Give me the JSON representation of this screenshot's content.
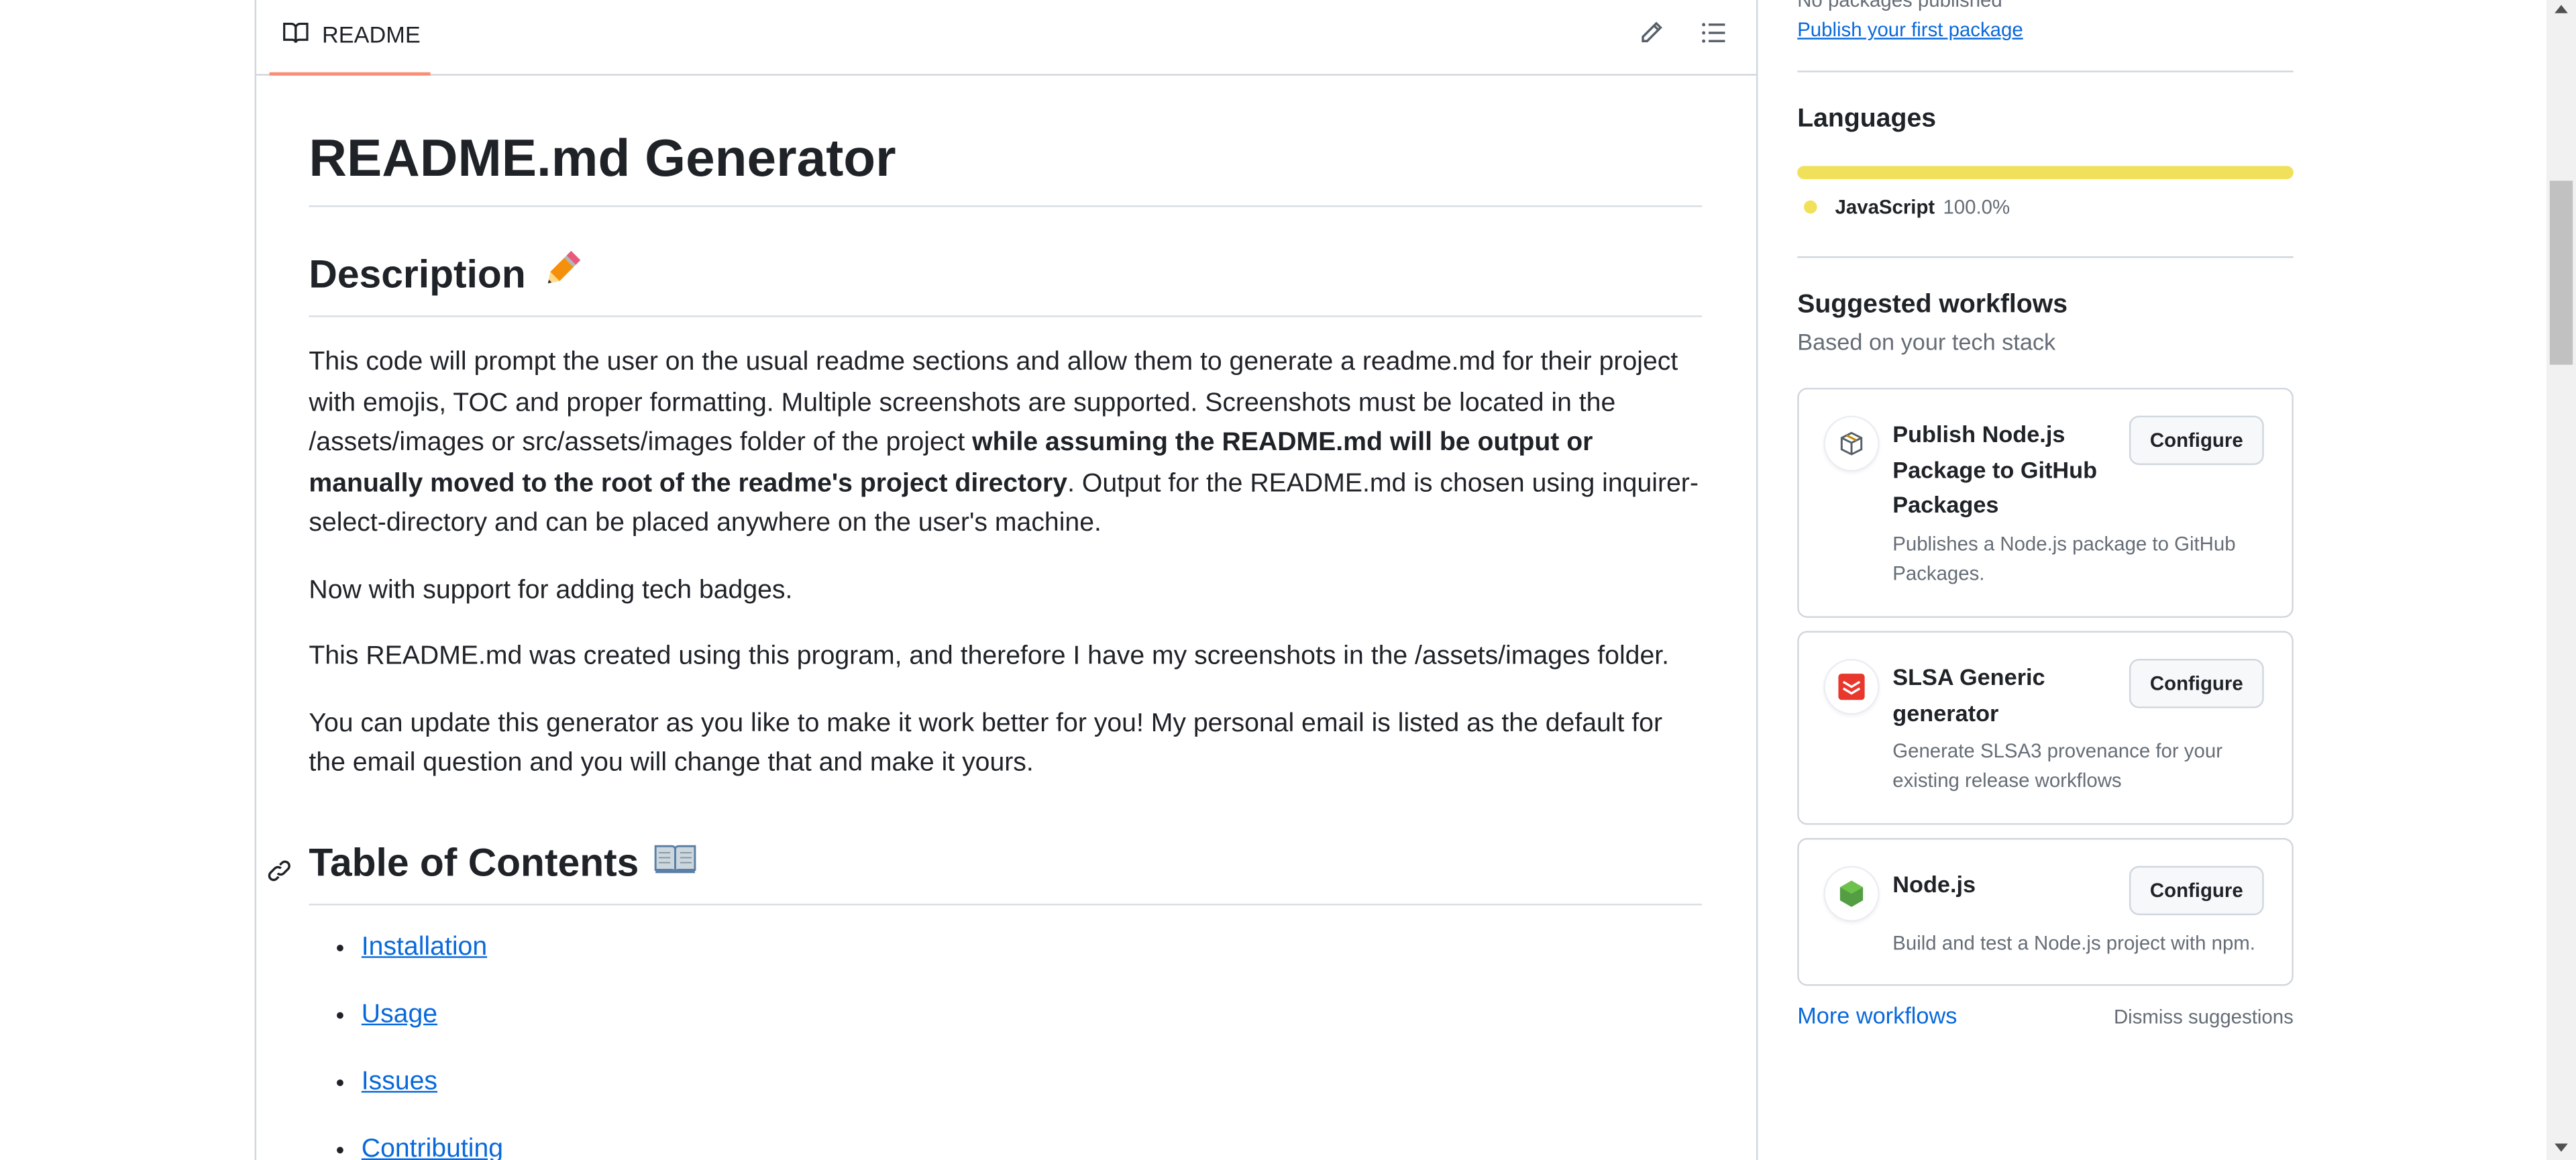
{
  "readme": {
    "tab_label": "README",
    "title": "README.md Generator",
    "description_heading": "Description",
    "description_heading_emoji": "✏️",
    "paragraph1_pre": "This code will prompt the user on the usual readme sections and allow them to generate a readme.md for their project with emojis, TOC and proper formatting. Multiple screenshots are supported. Screenshots must be located in the /assets/images or src/assets/images folder of the project ",
    "paragraph1_bold": "while assuming the README.md will be output or manually moved to the root of the readme's project directory",
    "paragraph1_post": ". Output for the README.md is chosen using inquirer-select-directory and can be placed anywhere on the user's machine.",
    "paragraph2": "Now with support for adding tech badges.",
    "paragraph3": "This README.md was created using this program, and therefore I have my screenshots in the /assets/images folder.",
    "paragraph4": "You can update this generator as you like to make it work better for you! My personal email is listed as the default for the email question and you will change that and make it yours.",
    "toc_heading": "Table of Contents",
    "toc_heading_emoji": "📖",
    "toc_items": [
      "Installation",
      "Usage",
      "Issues",
      "Contributing"
    ]
  },
  "sidebar": {
    "packages_status": "No packages published",
    "publish_link": "Publish your first package",
    "languages_heading": "Languages",
    "language_name": "JavaScript",
    "language_percent": "100.0%",
    "language_color": "#f1e05a",
    "workflows_heading": "Suggested workflows",
    "workflows_sub": "Based on your tech stack",
    "workflows": [
      {
        "title": "Publish Node.js Package to GitHub Packages",
        "desc": "Publishes a Node.js package to GitHub Packages.",
        "button": "Configure",
        "icon": "package-icon"
      },
      {
        "title": "SLSA Generic generator",
        "desc": "Generate SLSA3 provenance for your existing release workflows",
        "button": "Configure",
        "icon": "slsa-icon"
      },
      {
        "title": "Node.js",
        "desc": "Build and test a Node.js project with npm.",
        "button": "Configure",
        "icon": "nodejs-icon"
      }
    ],
    "more_workflows": "More workflows",
    "dismiss": "Dismiss suggestions"
  },
  "colors": {
    "link": "#0969da",
    "tab_underline": "#fd8c73",
    "border": "#d0d7de",
    "muted": "#656d76"
  }
}
